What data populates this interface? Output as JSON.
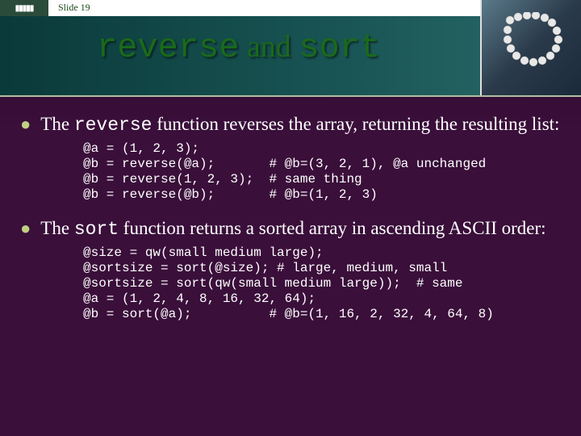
{
  "slide_number": "Slide 19",
  "title": {
    "part1_code": "reverse",
    "mid": " and ",
    "part2_code": "sort"
  },
  "bullet1": {
    "pre": "The ",
    "code": "reverse",
    "post": " function reverses the array, returning the resulting list:"
  },
  "code1": "@a = (1, 2, 3);\n@b = reverse(@a);       # @b=(3, 2, 1), @a unchanged\n@b = reverse(1, 2, 3);  # same thing\n@b = reverse(@b);       # @b=(1, 2, 3)",
  "bullet2": {
    "pre": "The ",
    "code": "sort",
    "post": " function returns a sorted array in ascending ASCII order:"
  },
  "code2": "@size = qw(small medium large);\n@sortsize = sort(@size); # large, medium, small\n@sortsize = sort(qw(small medium large));  # same\n@a = (1, 2, 4, 8, 16, 32, 64);\n@b = sort(@a);          # @b=(1, 16, 2, 32, 4, 64, 8)"
}
